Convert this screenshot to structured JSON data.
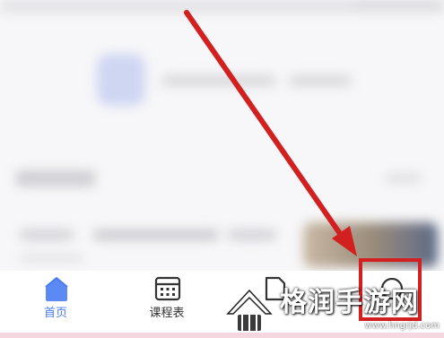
{
  "tabbar": {
    "items": [
      {
        "label": "首页",
        "icon": "home-icon",
        "active": true
      },
      {
        "label": "课程表",
        "icon": "schedule-icon",
        "active": false
      },
      {
        "label": "",
        "icon": "document-icon",
        "active": false
      },
      {
        "label": "",
        "icon": "profile-icon",
        "active": false
      }
    ]
  },
  "watermark": {
    "title": "格润手游网",
    "url": "www.hngrjd.com"
  },
  "colors": {
    "active_tab": "#4a7bf0",
    "annotation_red": "#d21f1f",
    "background": "#f7f7f9"
  }
}
